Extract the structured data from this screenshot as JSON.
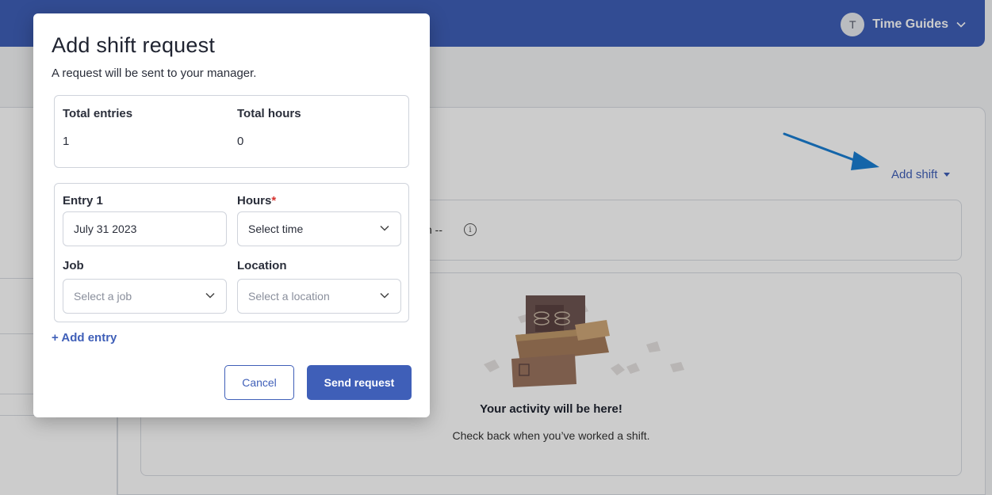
{
  "topbar": {
    "user_initial": "T",
    "user_name": "Time Guides"
  },
  "main": {
    "add_shift_label": "Add shift",
    "summary_dash": "n  --",
    "empty_state": {
      "title": "Your activity will be here!",
      "subtitle": "Check back when you’ve worked a shift."
    }
  },
  "modal": {
    "title": "Add shift request",
    "subtitle": "A request will be sent to your manager.",
    "totals": {
      "entries_label": "Total entries",
      "entries_value": "1",
      "hours_label": "Total hours",
      "hours_value": "0"
    },
    "entry": {
      "title": "Entry 1",
      "date_value": "July 31 2023",
      "hours_label": "Hours",
      "hours_required_mark": "*",
      "hours_placeholder": "Select time",
      "job_label": "Job",
      "job_placeholder": "Select a job",
      "location_label": "Location",
      "location_placeholder": "Select a location"
    },
    "add_entry_label": "+ Add entry",
    "cancel_label": "Cancel",
    "send_label": "Send request"
  },
  "colors": {
    "brand": "#3f5fb8",
    "required": "#d6332f",
    "annotation_arrow": "#1a7fd4"
  }
}
